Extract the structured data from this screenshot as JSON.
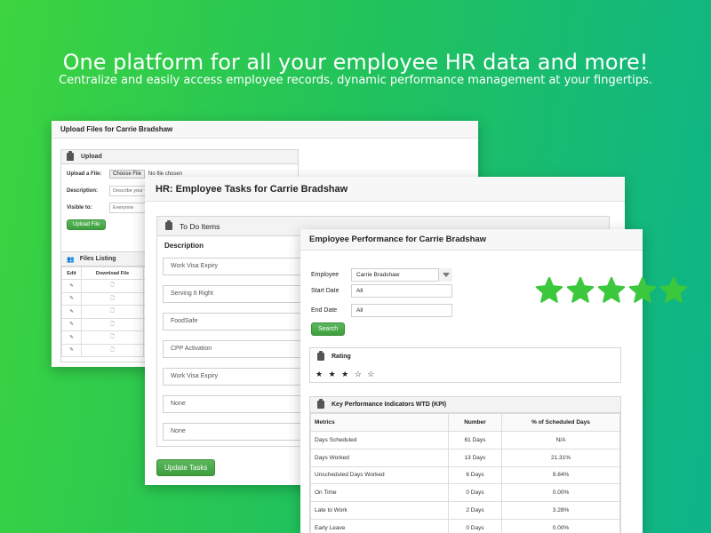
{
  "hero": {
    "title": "One platform for all your employee HR data and more!",
    "subtitle": "Centralize and easily access employee records, dynamic performance management at your fingertips."
  },
  "upload_panel": {
    "title": "Upload Files for Carrie Bradshaw",
    "box_title": "Upload",
    "file_label": "Upload a File:",
    "file_button": "Choose File",
    "file_status": "No file chosen",
    "description_label": "Description:",
    "description_placeholder": "Describe your file",
    "visible_label": "Visible to:",
    "visible_value": "Everyone",
    "upload_button": "Upload File",
    "files_title": "Files Listing",
    "files_cols": [
      "Edit",
      "Download File"
    ],
    "file_rows": 6
  },
  "tasks_panel": {
    "title": "HR: Employee Tasks for Carrie Bradshaw",
    "box_title": "To Do Items",
    "col_description": "Description",
    "tasks": [
      "Work Visa Expiry",
      "Serving It Right",
      "FoodSafe",
      "CPP Activation",
      "Work Visa Expiry",
      "None",
      "None"
    ],
    "update_button": "Update Tasks"
  },
  "perf_panel": {
    "title": "Employee Performance for Carrie Bradshaw",
    "employee_label": "Employee",
    "employee_value": "Carrie Bradshaw",
    "start_label": "Start Date",
    "start_value": "All",
    "end_label": "End Date",
    "end_value": "All",
    "search_button": "Search",
    "rating_title": "Rating",
    "rating_stars": "★ ★ ★ ☆ ☆",
    "rating_value": 3,
    "rating_max": 5,
    "kpi_title": "Key Performance Indicators WTD (KPI)",
    "kpi_cols": [
      "Metrics",
      "Number",
      "% of Scheduled Days"
    ],
    "kpi_rows": [
      {
        "metric": "Days Scheduled",
        "number": "61 Days",
        "pct": "N/A"
      },
      {
        "metric": "Days Worked",
        "number": "13 Days",
        "pct": "21.31%"
      },
      {
        "metric": "Unscheduled Days Worked",
        "number": "6 Days",
        "pct": "9.84%"
      },
      {
        "metric": "On Time",
        "number": "0 Days",
        "pct": "0.00%"
      },
      {
        "metric": "Late to Work",
        "number": "2 Days",
        "pct": "3.28%"
      },
      {
        "metric": "Early Leave",
        "number": "0 Days",
        "pct": "0.00%"
      }
    ]
  },
  "big_stars": {
    "count": 5,
    "color": "#3cc83c"
  },
  "colors": {
    "accent": "#4cae4c",
    "bg_start": "#3dd43f",
    "bg_end": "#0db48a"
  }
}
